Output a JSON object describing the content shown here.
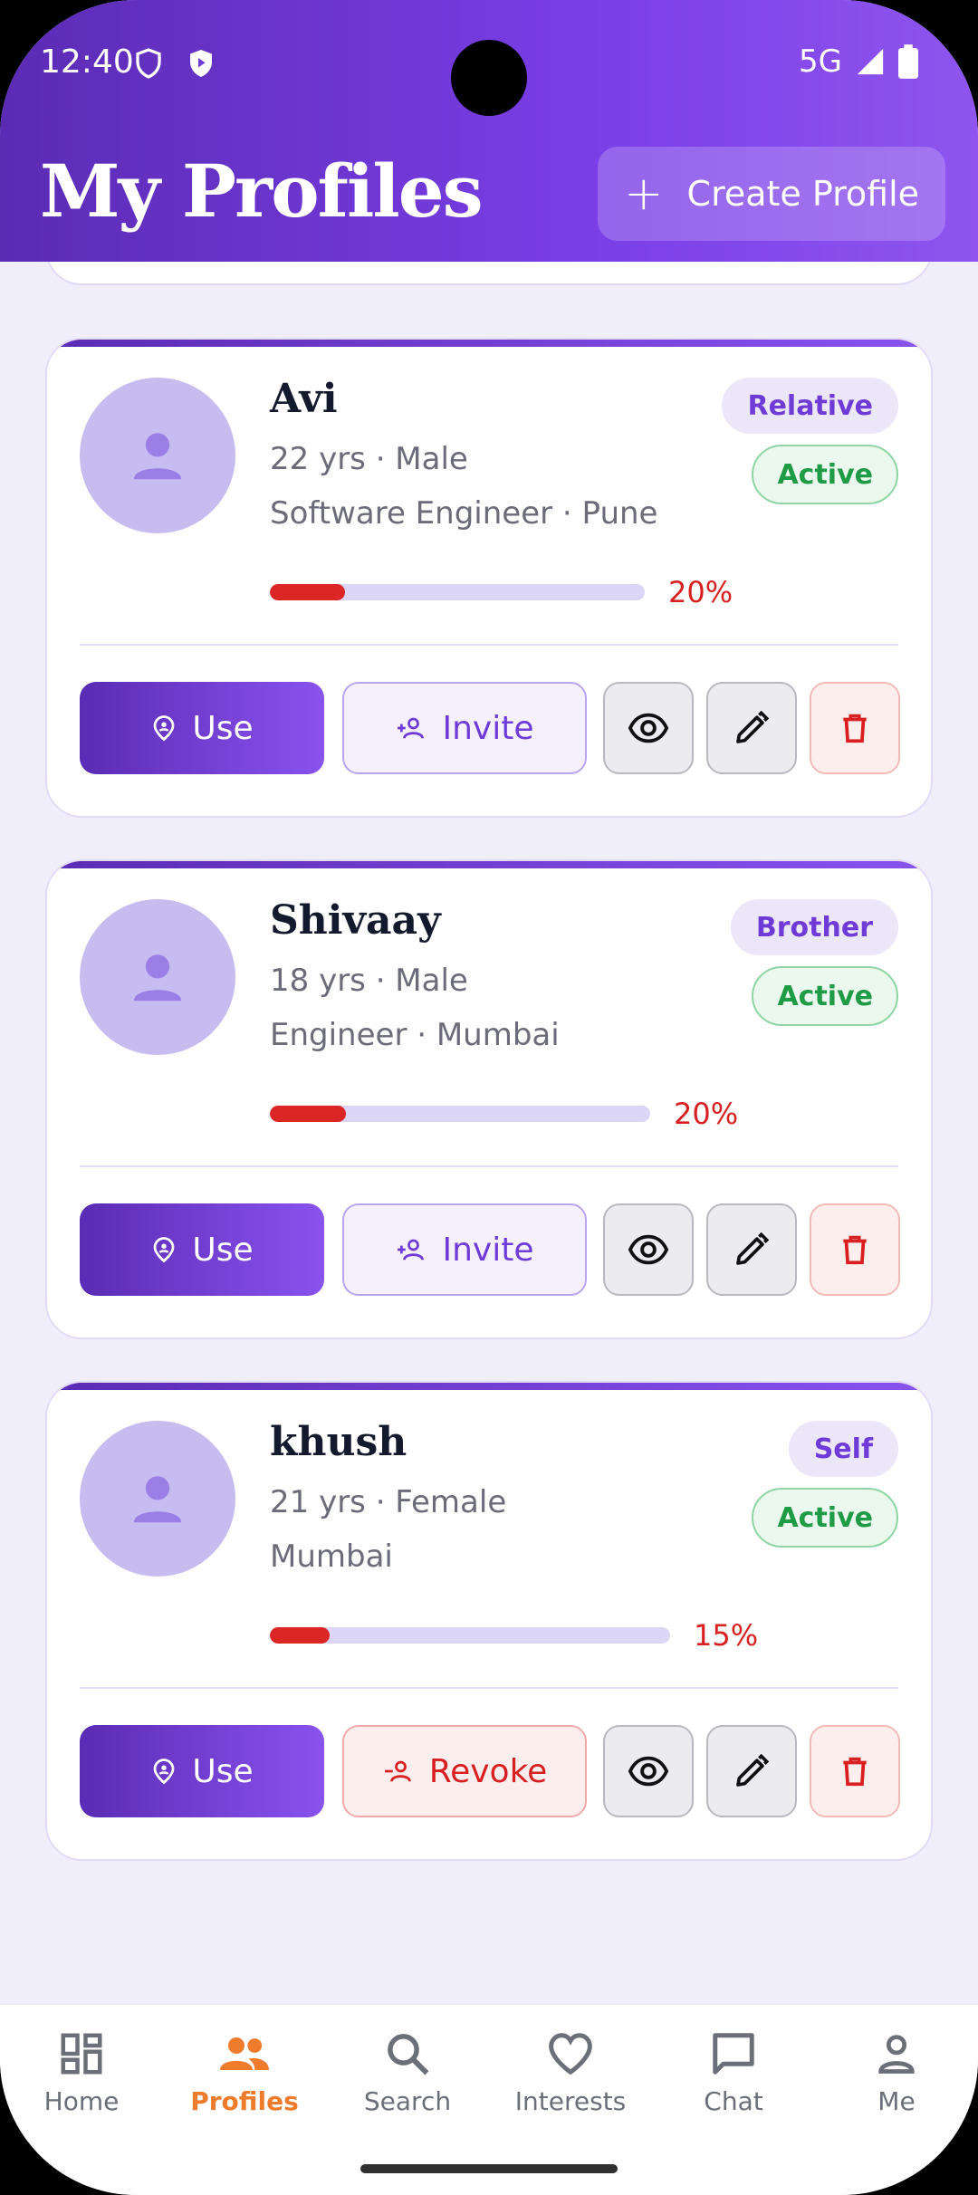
{
  "status_bar": {
    "time": "12:40",
    "network": "5G"
  },
  "header": {
    "title": "My Profiles",
    "create_button_label": "Create Profile"
  },
  "colors": {
    "brand_purple": "#6f3bd6",
    "active_green": "#1f9a45",
    "danger_red": "#d92020",
    "nav_active": "#ef7b2d"
  },
  "profiles": [
    {
      "name": "Avi",
      "relation": "Relative",
      "status": "Active",
      "meta_line1": "22 yrs · Male",
      "meta_line2": "Software Engineer · Pune",
      "completion_pct": 20,
      "completion_label": "20%",
      "use_label": "Use",
      "secondary_label": "Invite",
      "secondary_type": "invite"
    },
    {
      "name": "Shivaay",
      "relation": "Brother",
      "status": "Active",
      "meta_line1": "18 yrs · Male",
      "meta_line2": "Engineer · Mumbai",
      "completion_pct": 20,
      "completion_label": "20%",
      "use_label": "Use",
      "secondary_label": "Invite",
      "secondary_type": "invite"
    },
    {
      "name": "khush",
      "relation": "Self",
      "status": "Active",
      "meta_line1": "21 yrs · Female",
      "meta_line2": "Mumbai",
      "completion_pct": 15,
      "completion_label": "15%",
      "use_label": "Use",
      "secondary_label": "Revoke",
      "secondary_type": "revoke"
    }
  ],
  "bottom_nav": {
    "items": [
      {
        "label": "Home",
        "icon": "dashboard-icon"
      },
      {
        "label": "Profiles",
        "icon": "people-icon",
        "active": true
      },
      {
        "label": "Search",
        "icon": "search-icon"
      },
      {
        "label": "Interests",
        "icon": "heart-icon"
      },
      {
        "label": "Chat",
        "icon": "chat-icon"
      },
      {
        "label": "Me",
        "icon": "person-icon"
      }
    ]
  }
}
